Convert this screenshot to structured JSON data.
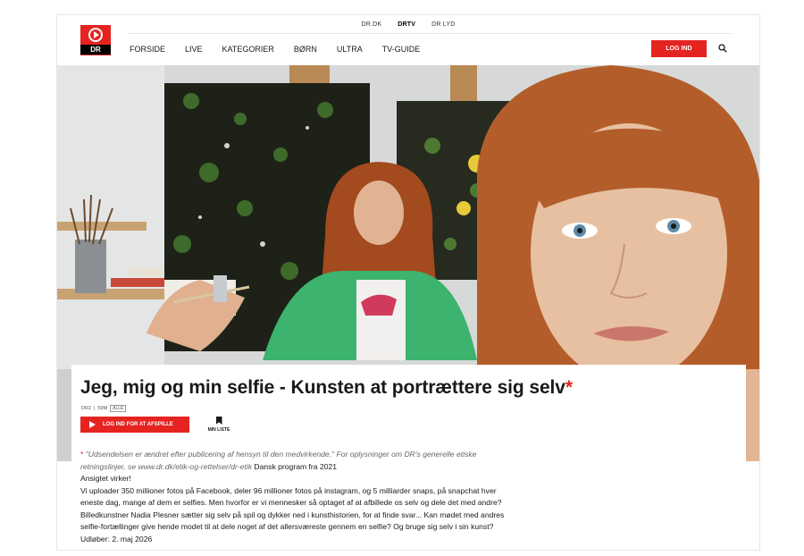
{
  "topbar": {
    "links": [
      "DR.DK",
      "DRTV",
      "DR LYD"
    ],
    "active": "DRTV"
  },
  "logo": {
    "text": "DR"
  },
  "nav": {
    "items": [
      "FORSIDE",
      "LIVE",
      "KATEGORIER",
      "BØRN",
      "ULTRA",
      "TV-GUIDE"
    ]
  },
  "header": {
    "login_label": "LOG IND"
  },
  "program": {
    "title": "Jeg, mig og min selfie - Kunsten at portrættere sig selv",
    "title_star": "*",
    "channel": "DR2",
    "duration": "59M",
    "age_badge": "ALLE",
    "play_label": "LOG IND FOR AT AFSPILLE",
    "my_list_label": "MIN LISTE",
    "note_star": "*",
    "note": "\"Udsendelsen er ændret efter publicering af hensyn til den medvirkende.\" For oplysninger om DR's generelle etiske retningslinjer, se www.dr.dk/etik-og-rettelser/dr-etik",
    "origin": "Dansk program fra 2021",
    "tagline": "Ansigtet virker!",
    "paragraph1": "Vi uploader 350 millioner fotos på Facebook, deler 96 millioner fotos på instagram, og 5 milliarder snaps, på snapchat hver eneste dag, mange af dem er selfies. Men hvorfor er vi mennesker så optaget af at afbillede os selv og dele det med andre?",
    "paragraph2": "Billedkunstner Nadia Plesner sætter sig selv på spil og dykker ned i kunsthistorien, for at finde svar... Kan mødet med andres selfie-fortællinger give hende modet til at dele noget af det allersværeste gennem en selfie? Og bruge sig selv i sin kunst? Udløber: 2. maj 2026"
  },
  "colors": {
    "brand": "#e52421",
    "text": "#1a1a1a"
  },
  "icons": {
    "logo": "dr-play-logo",
    "search": "search-icon",
    "bookmark": "bookmark-icon",
    "play": "play-icon"
  }
}
